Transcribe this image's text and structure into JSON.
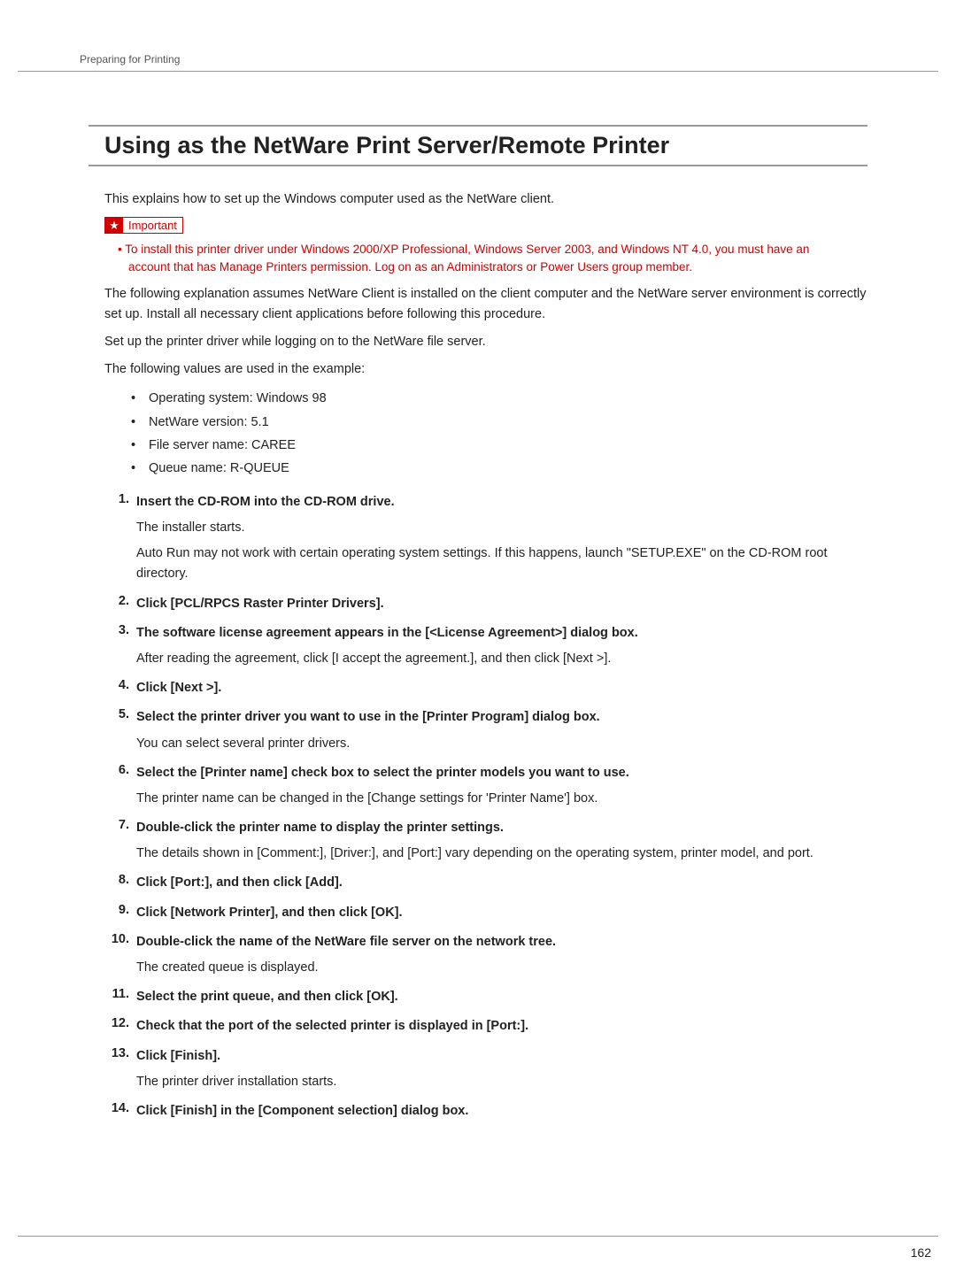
{
  "header": {
    "running": "Preparing for Printing"
  },
  "title": "Using as the NetWare Print Server/Remote Printer",
  "intro": "This explains how to set up the Windows computer used as the NetWare client.",
  "important": {
    "label": "Important",
    "note": "• To install this printer driver under Windows 2000/XP Professional, Windows Server 2003, and Windows NT 4.0, you must have an account that has Manage Printers permission. Log on as an Administrators or Power Users group member."
  },
  "paras": {
    "p1": "The following explanation assumes NetWare Client is installed on the client computer and the NetWare server environment is correctly set up. Install all necessary client applications before following this procedure.",
    "p2": "Set up the printer driver while logging on to the NetWare file server.",
    "p3": "The following values are used in the example:"
  },
  "example": {
    "i1": "Operating system: Windows 98",
    "i2": "NetWare version: 5.1",
    "i3": "File server name: CAREE",
    "i4": "Queue name: R-QUEUE"
  },
  "steps": {
    "s1t": "Insert the CD-ROM into the CD-ROM drive.",
    "s1d1": "The installer starts.",
    "s1d2": "Auto Run may not work with certain operating system settings. If this happens, launch \"SETUP.EXE\" on the CD-ROM root directory.",
    "s2t": "Click [PCL/RPCS Raster Printer Drivers].",
    "s3t": "The software license agreement appears in the [<License Agreement>] dialog box.",
    "s3d": "After reading the agreement, click [I accept the agreement.], and then click [Next >].",
    "s4t": "Click [Next >].",
    "s5t": "Select the printer driver you want to use in the [Printer Program] dialog box.",
    "s5d": "You can select several printer drivers.",
    "s6t": "Select the [Printer name] check box to select the printer models you want to use.",
    "s6d": "The printer name can be changed in the [Change settings for 'Printer Name'] box.",
    "s7t": "Double-click the printer name to display the printer settings.",
    "s7d": "The details shown in [Comment:], [Driver:], and [Port:] vary depending on the operating system, printer model, and port.",
    "s8t": "Click [Port:], and then click [Add].",
    "s9t": "Click [Network Printer], and then click [OK].",
    "s10t": "Double-click the name of the NetWare file server on the network tree.",
    "s10d": "The created queue is displayed.",
    "s11t": "Select the print queue, and then click [OK].",
    "s12t": "Check that the port of the selected printer is displayed in [Port:].",
    "s13t": "Click [Finish].",
    "s13d": "The printer driver installation starts.",
    "s14t": "Click [Finish] in the [Component selection] dialog box."
  },
  "pageNumber": "162"
}
